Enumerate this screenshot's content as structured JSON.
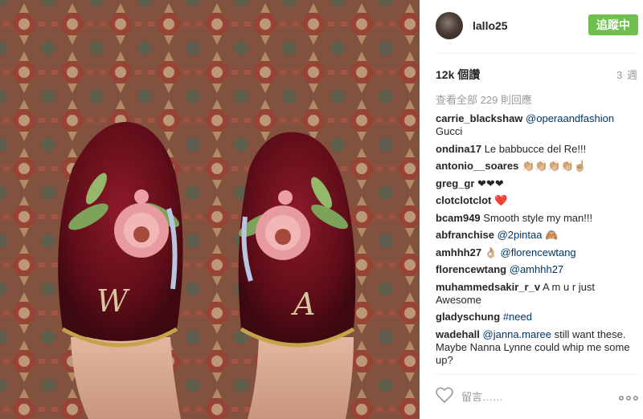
{
  "post": {
    "username": "lallo25",
    "follow_label": "追蹤中",
    "views": "12k 個讚",
    "age": "3 週",
    "view_all": "查看全部 229 則回應",
    "add_comment_placeholder": "留言……"
  },
  "comments": [
    {
      "user": "carrie_blackshaw",
      "parts": [
        {
          "t": "mention",
          "v": "@operaandfashion"
        },
        {
          "t": "text",
          "v": " Gucci"
        }
      ]
    },
    {
      "user": "ondina17",
      "parts": [
        {
          "t": "text",
          "v": "Le babbucce del Re!!!"
        }
      ]
    },
    {
      "user": "antonio__soares",
      "parts": [
        {
          "t": "text",
          "v": "👏🏼👏🏼👏🏼👏🏼☝🏼"
        }
      ]
    },
    {
      "user": "greg_gr",
      "parts": [
        {
          "t": "text",
          "v": "❤❤❤"
        }
      ]
    },
    {
      "user": "clotclotclot",
      "parts": [
        {
          "t": "text",
          "v": "❤️"
        }
      ]
    },
    {
      "user": "bcam949",
      "parts": [
        {
          "t": "text",
          "v": "Smooth style my man!!!"
        }
      ]
    },
    {
      "user": "abfranchise",
      "parts": [
        {
          "t": "mention",
          "v": "@2pintaa"
        },
        {
          "t": "text",
          "v": " 🙈"
        }
      ]
    },
    {
      "user": "amhhh27",
      "parts": [
        {
          "t": "text",
          "v": "👌🏼 "
        },
        {
          "t": "mention",
          "v": "@florencewtang"
        }
      ]
    },
    {
      "user": "florencewtang",
      "parts": [
        {
          "t": "mention",
          "v": "@amhhh27"
        }
      ]
    },
    {
      "user": "muhammedsakir_r_v",
      "parts": [
        {
          "t": "text",
          "v": "A m u r just Awesome"
        }
      ]
    },
    {
      "user": "gladyschung",
      "parts": [
        {
          "t": "hash",
          "v": "#need"
        }
      ]
    },
    {
      "user": "wadehall",
      "parts": [
        {
          "t": "mention",
          "v": "@janna.maree"
        },
        {
          "t": "text",
          "v": " still want these. Maybe Nanna Lynne could whip me some up?"
        }
      ]
    }
  ],
  "icons": {
    "like": "heart-icon",
    "more": "more-options-icon"
  },
  "colors": {
    "follow_bg": "#70c050",
    "link": "#003569",
    "muted": "#999999"
  }
}
